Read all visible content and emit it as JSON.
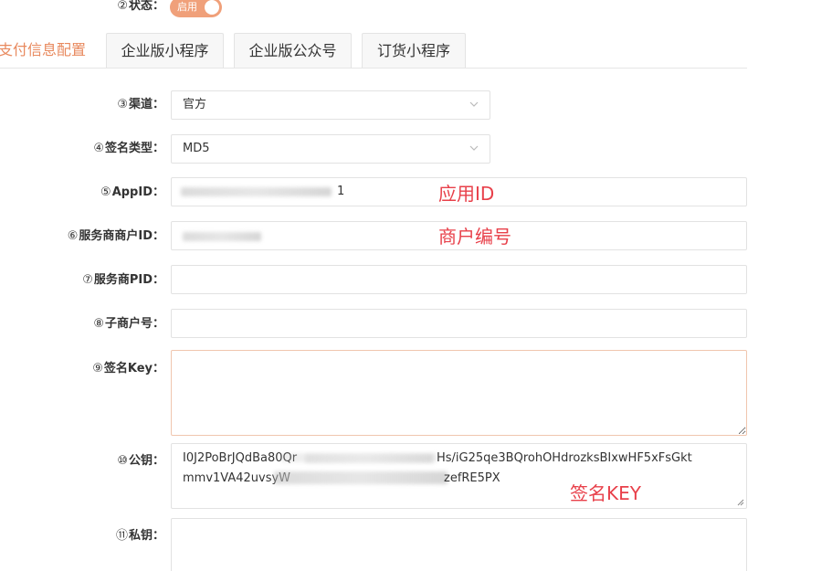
{
  "status": {
    "num": "②",
    "label": "状态：",
    "toggle_text": "启用",
    "enabled": true
  },
  "tabs": [
    {
      "label": "支付信息配置",
      "active": true
    },
    {
      "label": "企业版小程序",
      "active": false
    },
    {
      "label": "企业版公众号",
      "active": false
    },
    {
      "label": "订货小程序",
      "active": false
    }
  ],
  "form": {
    "channel": {
      "num": "③",
      "label": "渠道：",
      "value": "官方"
    },
    "sign_type": {
      "num": "④",
      "label": "签名类型：",
      "value": "MD5"
    },
    "appid": {
      "num": "⑤",
      "label": "AppID：",
      "value_suffix": "1"
    },
    "merchant_id": {
      "num": "⑥",
      "label": "服务商商户ID：",
      "value": ""
    },
    "pid": {
      "num": "⑦",
      "label": "服务商PID：",
      "value": ""
    },
    "sub_merchant": {
      "num": "⑧",
      "label": "子商户号：",
      "value": ""
    },
    "sign_key": {
      "num": "⑨",
      "label": "签名Key：",
      "value": ""
    },
    "public_key": {
      "num": "⑩",
      "label": "公钥：",
      "line1": "I0J2PoBrJQdBa80Qr",
      "line1_tail": "Hs/iG25qe3BQrohOHdrozksBIxwHF5xFsGkt",
      "line2_head": "mmv1VA42uvsyW",
      "line2_tail": "zefRE5PX"
    },
    "private_key": {
      "num": "⑪",
      "label": "私钥：",
      "value": ""
    }
  },
  "annotations": {
    "appid_note": "应用ID",
    "merchant_note": "商户编号",
    "key_note": "签名KEY"
  },
  "colors": {
    "accent": "#e8895e",
    "toggle_bg": "#f0a07a",
    "annotation": "#e8404a"
  }
}
